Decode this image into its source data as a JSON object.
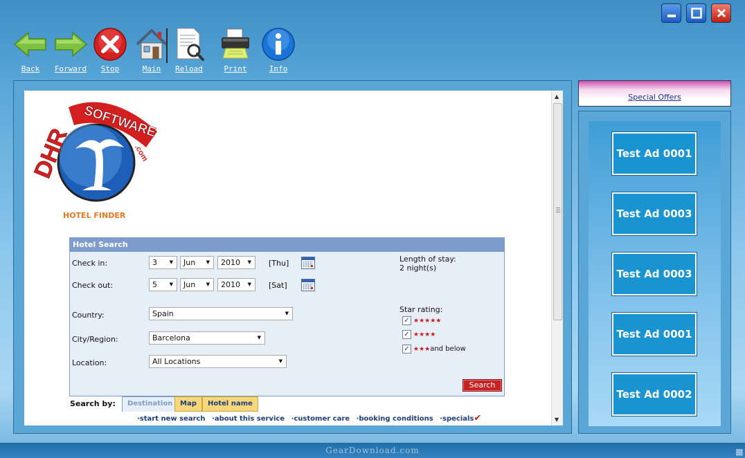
{
  "window": {
    "minimize_icon": "minimize-icon",
    "maximize_icon": "maximize-icon",
    "close_icon": "close-icon"
  },
  "toolbar": {
    "back": "Back",
    "forward": "Forward",
    "stop": "Stop",
    "main": "Main",
    "reload": "Reload",
    "print": "Print",
    "info": "Info"
  },
  "logo": {
    "brand_left": "DHR",
    "brand_top": "SOFTWARE",
    "brand_suffix": ".com",
    "subtitle": "HOTEL FINDER"
  },
  "hotel_search": {
    "title": "Hotel Search",
    "checkin_label": "Check in:",
    "checkin_day": "3",
    "checkin_month": "Jun",
    "checkin_year": "2010",
    "checkin_weekday": "[Thu]",
    "checkout_label": "Check out:",
    "checkout_day": "5",
    "checkout_month": "Jun",
    "checkout_year": "2010",
    "checkout_weekday": "[Sat]",
    "length_label": "Length of stay:",
    "length_value": "2 night(s)",
    "country_label": "Country:",
    "country_value": "Spain",
    "city_label": "City/Region:",
    "city_value": "Barcelona",
    "location_label": "Location:",
    "location_value": "All Locations",
    "star_label": "Star rating:",
    "star5": "★★★★★",
    "star4": "★★★★",
    "star3": "★★★",
    "star3_suffix": "and below",
    "search_button": "Search"
  },
  "search_by": {
    "label": "Search by:",
    "tabs": [
      "Destination",
      "Map",
      "Hotel name"
    ]
  },
  "footer_links": [
    "·start new search",
    "·about this service",
    "·customer care",
    "·booking conditions",
    "·specials"
  ],
  "sidebar": {
    "special_offers": "Special Offers",
    "ads": [
      "Test Ad 0001",
      "Test Ad 0003",
      "Test Ad 0003",
      "Test Ad 0001",
      "Test Ad 0002"
    ]
  },
  "watermark": "GearDownload.com"
}
